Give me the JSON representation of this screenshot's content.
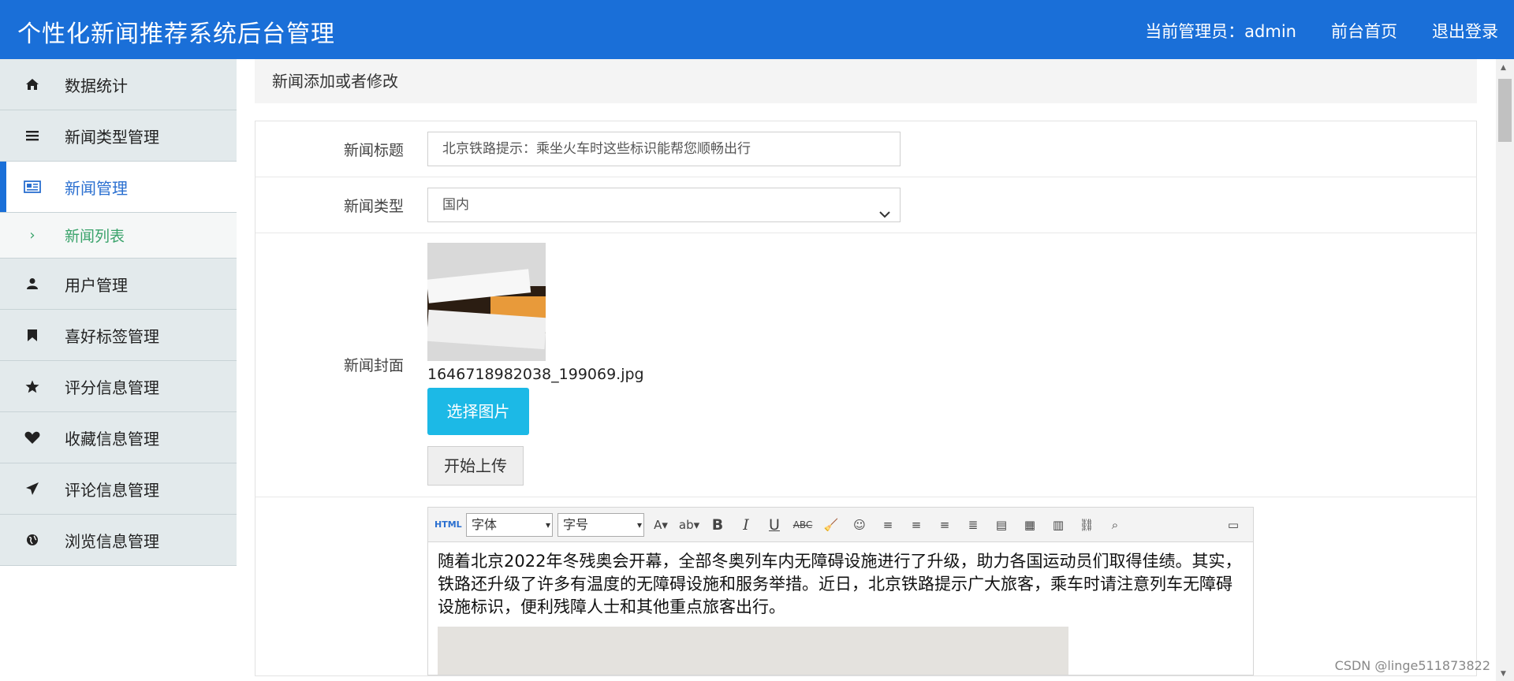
{
  "header": {
    "title": "个性化新闻推荐系统后台管理",
    "admin_label": "当前管理员：admin",
    "home_link": "前台首页",
    "logout_link": "退出登录"
  },
  "sidebar": {
    "items": [
      {
        "label": "数据统计",
        "icon": "home-icon"
      },
      {
        "label": "新闻类型管理",
        "icon": "list-icon"
      },
      {
        "label": "新闻管理",
        "icon": "newspaper-icon"
      },
      {
        "label": "新闻列表",
        "icon": "chevron-right-icon"
      },
      {
        "label": "用户管理",
        "icon": "user-icon"
      },
      {
        "label": "喜好标签管理",
        "icon": "bookmark-icon"
      },
      {
        "label": "评分信息管理",
        "icon": "star-icon"
      },
      {
        "label": "收藏信息管理",
        "icon": "heart-icon"
      },
      {
        "label": "评论信息管理",
        "icon": "send-icon"
      },
      {
        "label": "浏览信息管理",
        "icon": "globe-icon"
      }
    ]
  },
  "main": {
    "panel_title": "新闻添加或者修改",
    "title_label": "新闻标题",
    "title_value": "北京铁路提示：乘坐火车时这些标识能帮您顺畅出行",
    "type_label": "新闻类型",
    "type_value": "国内",
    "cover_label": "新闻封面",
    "cover_filename": "1646718982038_199069.jpg",
    "choose_button": "选择图片",
    "upload_button": "开始上传"
  },
  "editor": {
    "html_label": "HTML",
    "font_select": "字体",
    "size_select": "字号",
    "content_text": "随着北京2022年冬残奥会开幕，全部冬奥列车内无障碍设施进行了升级，助力各国运动员们取得佳绩。其实，铁路还升级了许多有温度的无障碍设施和服务举措。近日，北京铁路提示广大旅客，乘车时请注意列车无障碍设施标识，便利残障人士和其他重点旅客出行。"
  },
  "watermark": "CSDN @linge511873822",
  "colors": {
    "header": "#1a6fd8",
    "accent": "#1cb9e6",
    "sub_active": "#3aa36b"
  }
}
